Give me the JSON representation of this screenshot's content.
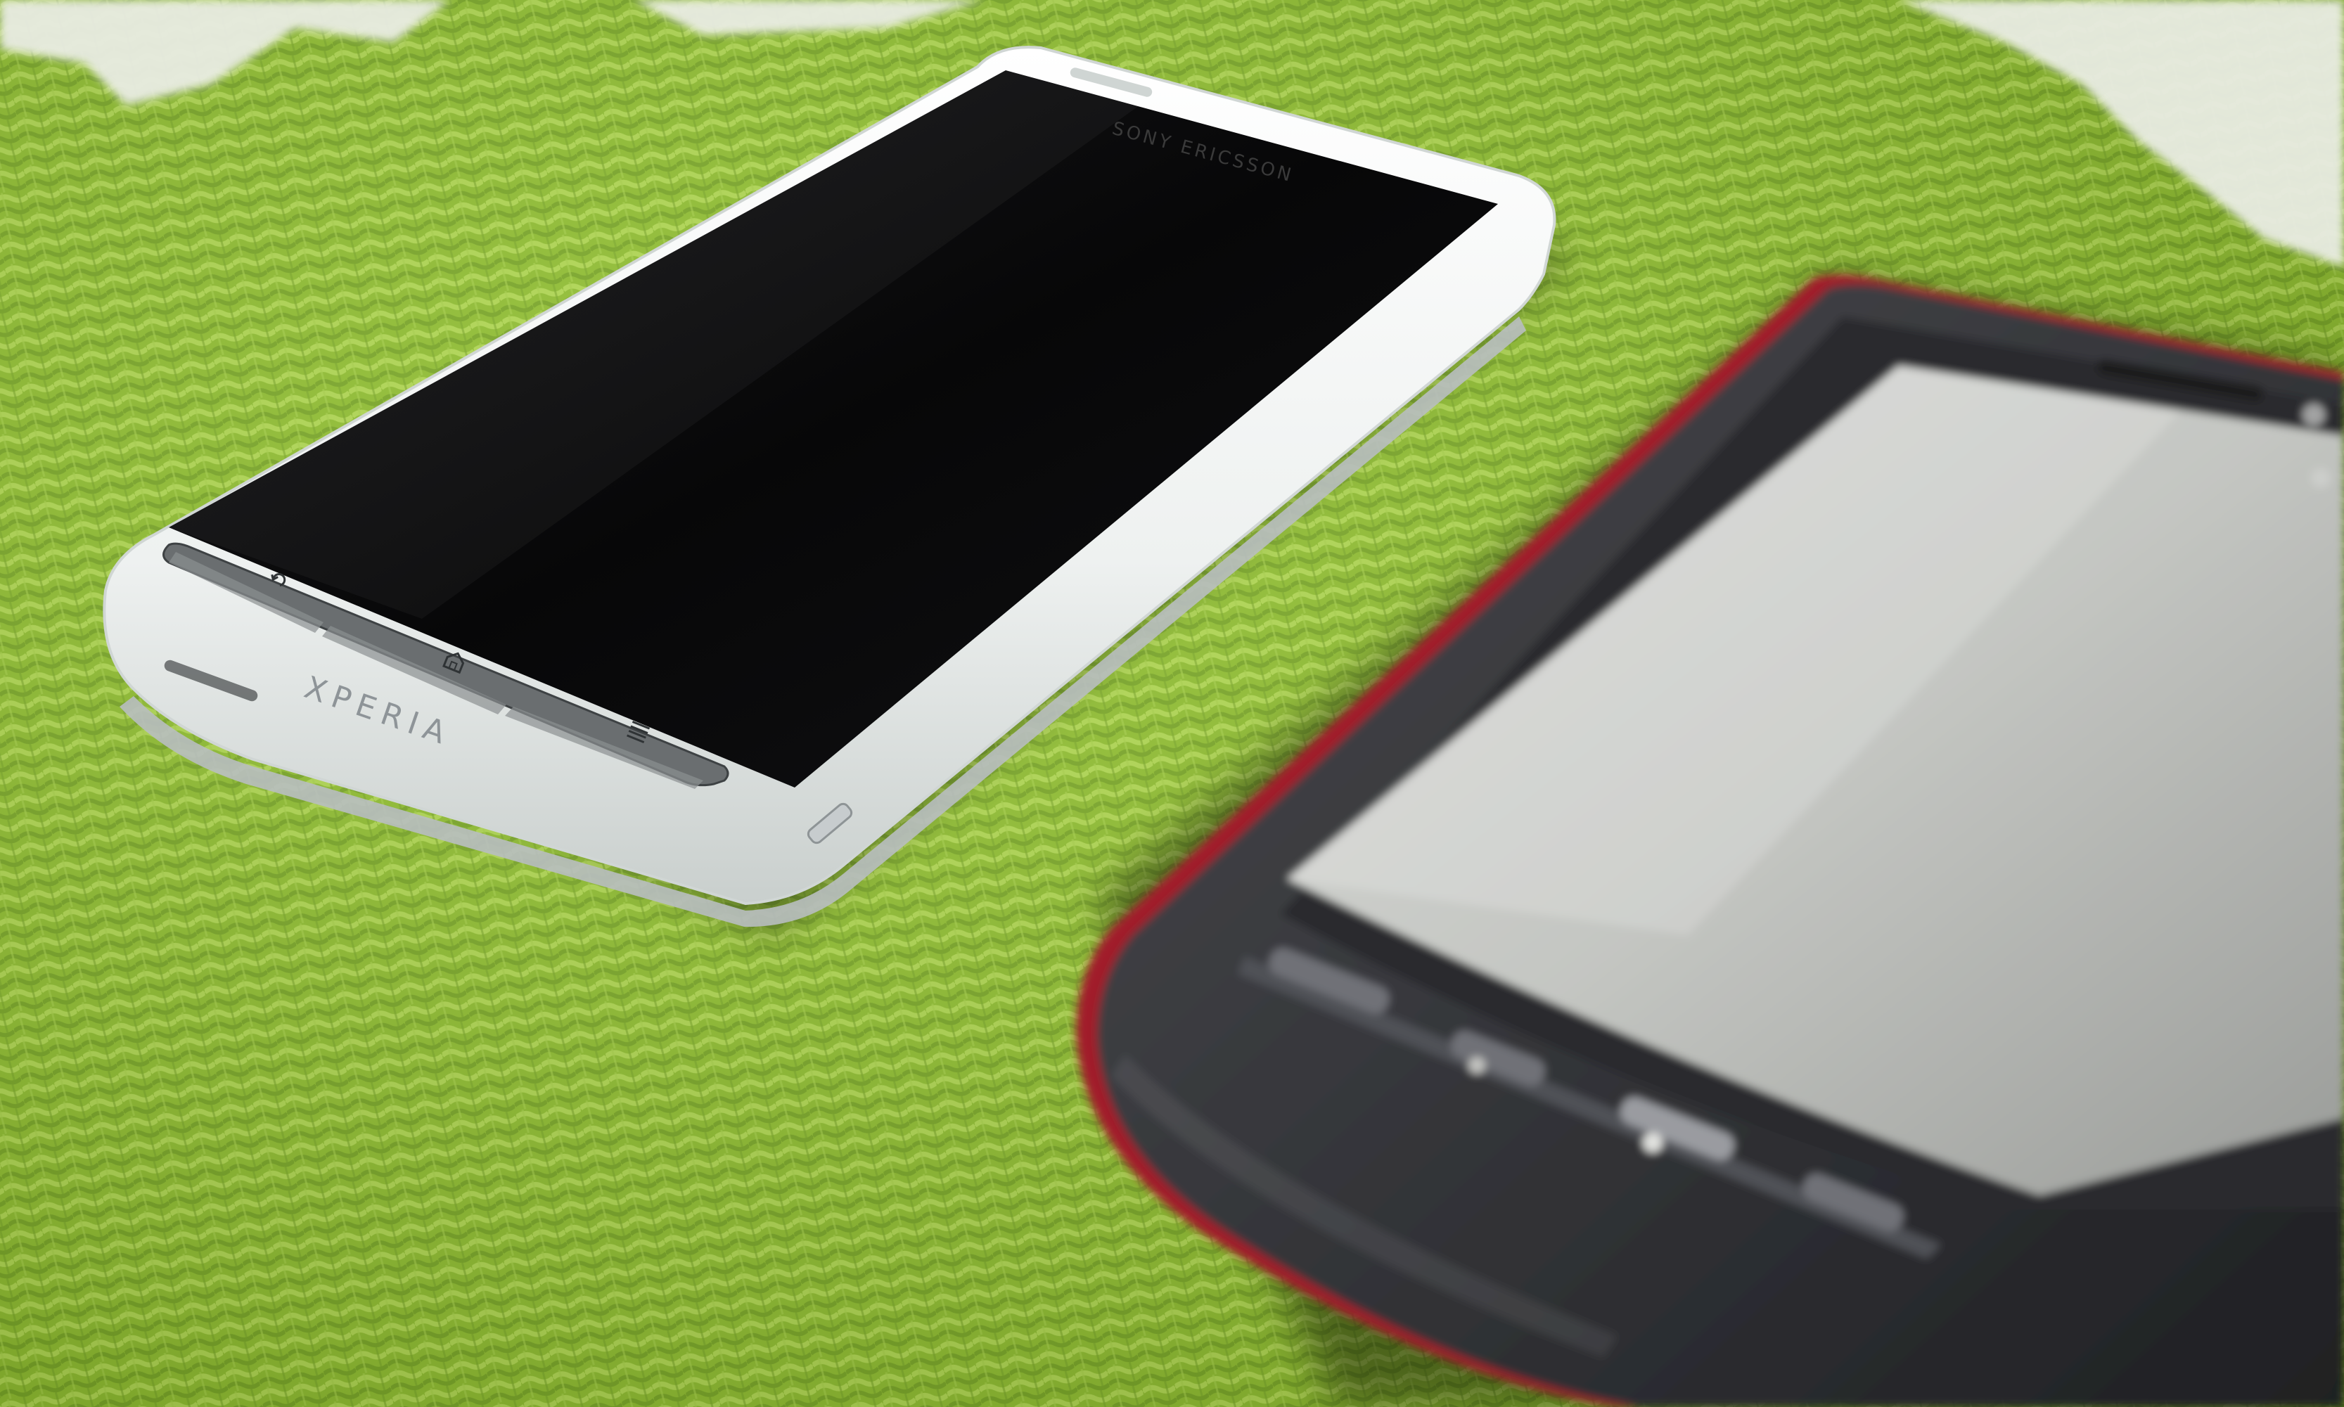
{
  "phone_left": {
    "brand_label": "XPERIA",
    "maker_label": "SONY ERICSSON",
    "body_color": "#f2f4f3",
    "screen_color": "#0b0b0c"
  },
  "phone_right": {
    "body_color": "#35363a",
    "accent_color": "#a11a2a",
    "screen_color": "#c9cbc7"
  },
  "surface": {
    "mat_color": "#8fbf2c",
    "pattern_color": "#e9ece3"
  }
}
